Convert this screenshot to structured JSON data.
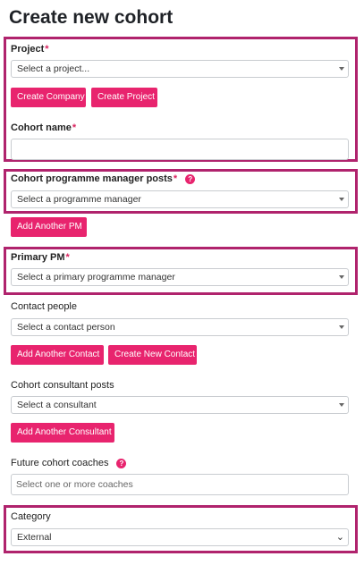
{
  "page": {
    "title": "Create new cohort"
  },
  "project": {
    "label": "Project",
    "required": "*",
    "placeholder": "Select a project...",
    "create_company_label": "Create Company",
    "create_project_label": "Create Project"
  },
  "cohort_name": {
    "label": "Cohort name",
    "required": "*",
    "value": ""
  },
  "pm_posts": {
    "label": "Cohort programme manager posts",
    "required": "*",
    "help_icon": "?",
    "placeholder": "Select a programme manager",
    "add_label": "Add Another PM"
  },
  "primary_pm": {
    "label": "Primary PM",
    "required": "*",
    "placeholder": "Select a primary programme manager"
  },
  "contact_people": {
    "label": "Contact people",
    "placeholder": "Select a contact person",
    "add_label": "Add Another Contact",
    "create_label": "Create New Contact"
  },
  "consultant_posts": {
    "label": "Cohort consultant posts",
    "placeholder": "Select a consultant",
    "add_label": "Add Another Consultant"
  },
  "future_coaches": {
    "label": "Future cohort coaches",
    "help_icon": "?",
    "placeholder": "Select one or more coaches"
  },
  "category": {
    "label": "Category",
    "value": "External"
  },
  "theme": {
    "accent": "#e8246e",
    "highlight_border": "#b0236d",
    "required_star": "#d9245f"
  }
}
